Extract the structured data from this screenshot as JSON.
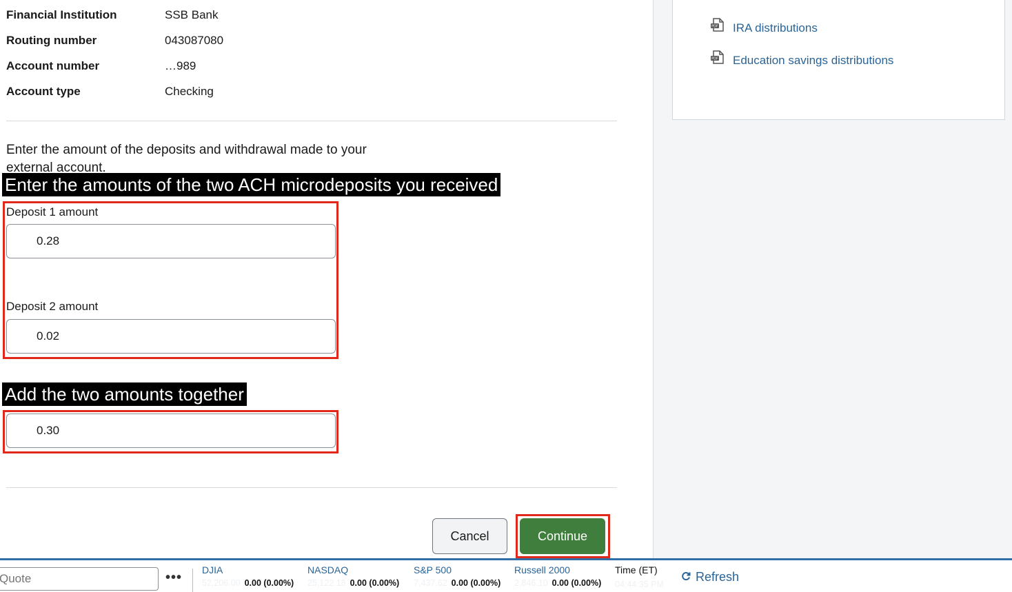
{
  "account_info": [
    {
      "label": "Financial Institution",
      "value": "SSB Bank"
    },
    {
      "label": "Routing number",
      "value": "043087080"
    },
    {
      "label": "Account number",
      "value": "…989"
    },
    {
      "label": "Account type",
      "value": "Checking"
    }
  ],
  "instructions": "Enter the amount of the deposits and withdrawal made to your external account.",
  "callouts": {
    "microdeposits": "Enter the amounts of the two ACH microdeposits you received",
    "add_together": "Add the two amounts together"
  },
  "form": {
    "deposit1_label": "Deposit 1 amount",
    "deposit1_value": "0.28",
    "deposit2_label": "Deposit 2 amount",
    "deposit2_value": "0.02",
    "total_value": "0.30"
  },
  "buttons": {
    "cancel": "Cancel",
    "continue": "Continue"
  },
  "documents": [
    {
      "label": "IRA distributions",
      "icon": "pdf-document-icon"
    },
    {
      "label": "Education savings distributions",
      "icon": "pdf-document-icon"
    }
  ],
  "ticker": {
    "quote_placeholder": "Quote",
    "more_icon": "ellipsis-icon",
    "indices": [
      {
        "name": "DJIA",
        "value": "52,206.00",
        "change": "0.00 (0.00%)"
      },
      {
        "name": "NASDAQ",
        "value": "25,122.18",
        "change": "0.00 (0.00%)"
      },
      {
        "name": "S&P 500",
        "value": "7,437.62",
        "change": "0.00 (0.00%)"
      },
      {
        "name": "Russell 2000",
        "value": "2,846.10",
        "change": "0.00 (0.00%)"
      }
    ],
    "time_label": "Time (ET)",
    "time_value": "04:44:35 PM",
    "refresh_label": "Refresh",
    "refresh_icon": "refresh-icon"
  },
  "colors": {
    "accent_link": "#2a6496",
    "continue_green": "#3f7e3c",
    "highlight_red": "#e0281b",
    "ticker_border": "#2f6ea7"
  }
}
